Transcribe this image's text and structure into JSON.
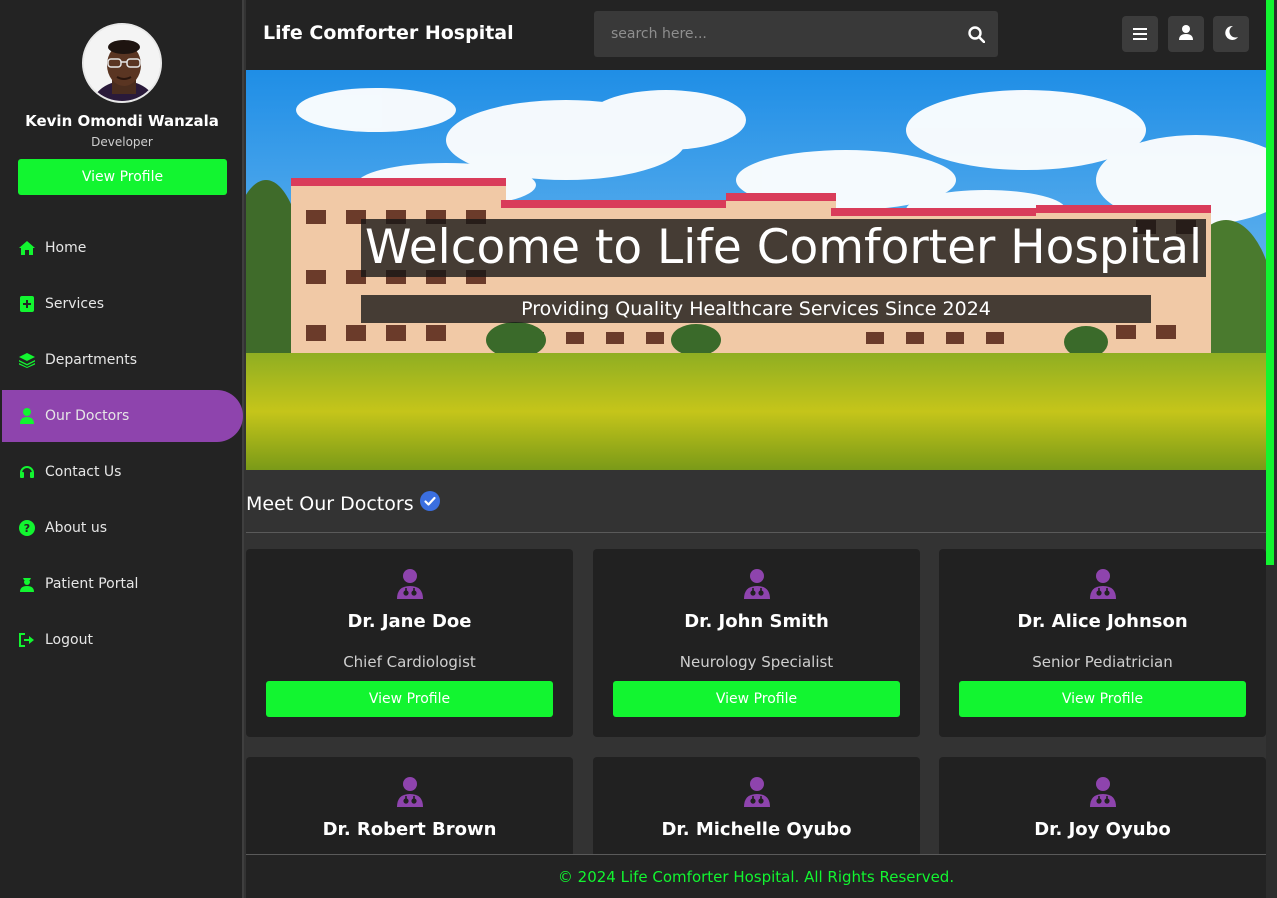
{
  "app": {
    "title": "Life Comforter Hospital"
  },
  "user": {
    "name": "Kevin Omondi Wanzala",
    "role": "Developer",
    "profile_button": "View Profile"
  },
  "sidebar": {
    "items": [
      {
        "label": "Home",
        "icon": "home-icon"
      },
      {
        "label": "Services",
        "icon": "medical-kit-icon"
      },
      {
        "label": "Departments",
        "icon": "layers-icon"
      },
      {
        "label": "Our Doctors",
        "icon": "doctor-icon",
        "active": true
      },
      {
        "label": "Contact Us",
        "icon": "headset-icon"
      },
      {
        "label": "About us",
        "icon": "question-icon"
      },
      {
        "label": "Patient Portal",
        "icon": "user-nurse-icon"
      },
      {
        "label": "Logout",
        "icon": "logout-icon"
      }
    ]
  },
  "search": {
    "placeholder": "search here..."
  },
  "toolbar": {
    "menu_icon": "menu-icon",
    "user_icon": "user-icon",
    "theme_icon": "moon-icon"
  },
  "hero": {
    "title": "Welcome to Life Comforter Hospital",
    "subtitle": "Providing Quality Healthcare Services Since 2024"
  },
  "section": {
    "title": "Meet Our Doctors",
    "icon": "verified-icon"
  },
  "doctors": [
    {
      "name": "Dr. Jane Doe",
      "role": "Chief Cardiologist",
      "button": "View Profile"
    },
    {
      "name": "Dr. John Smith",
      "role": "Neurology Specialist",
      "button": "View Profile"
    },
    {
      "name": "Dr. Alice Johnson",
      "role": "Senior Pediatrician",
      "button": "View Profile"
    },
    {
      "name": "Dr. Robert Brown"
    },
    {
      "name": "Dr. Michelle Oyubo"
    },
    {
      "name": "Dr. Joy Oyubo"
    }
  ],
  "footer": {
    "text": "© 2024 Life Comforter Hospital. All Rights Reserved."
  },
  "colors": {
    "accent": "#12f530",
    "active_nav": "#8e44ad",
    "doctor_icon": "#8e44ad",
    "verified": "#3b6fe0"
  }
}
